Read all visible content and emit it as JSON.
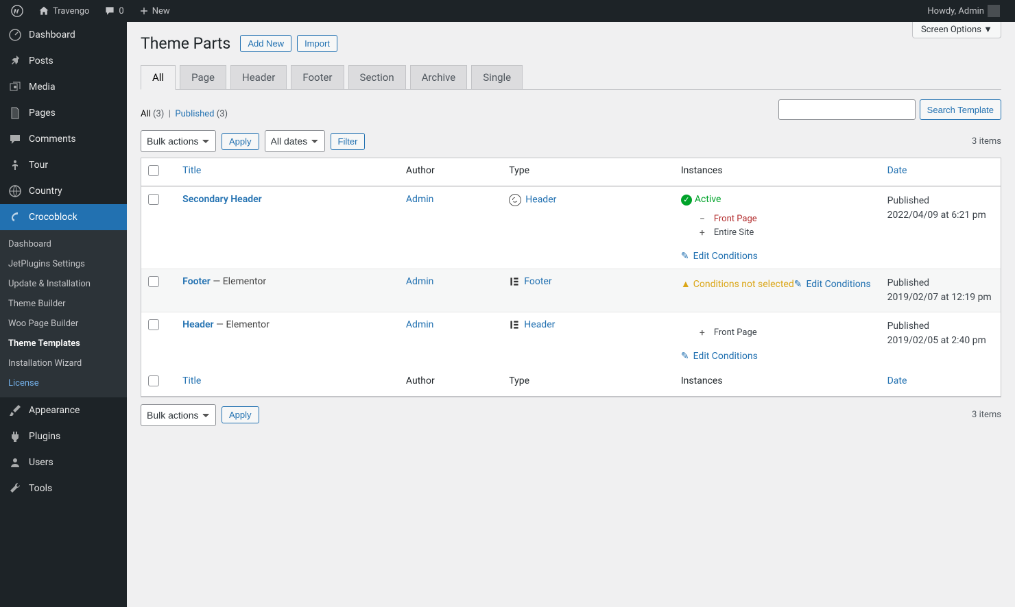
{
  "adminbar": {
    "site_name": "Travengo",
    "comments_count": "0",
    "new_label": "New",
    "howdy": "Howdy, Admin"
  },
  "sidebar": {
    "items": [
      {
        "label": "Dashboard",
        "icon": "dashboard"
      },
      {
        "label": "Posts",
        "icon": "pin"
      },
      {
        "label": "Media",
        "icon": "media"
      },
      {
        "label": "Pages",
        "icon": "page"
      },
      {
        "label": "Comments",
        "icon": "comment"
      },
      {
        "label": "Tour",
        "icon": "person"
      },
      {
        "label": "Country",
        "icon": "globe"
      },
      {
        "label": "Crocoblock",
        "icon": "croco"
      },
      {
        "label": "Appearance",
        "icon": "brush"
      },
      {
        "label": "Plugins",
        "icon": "plug"
      },
      {
        "label": "Users",
        "icon": "user"
      },
      {
        "label": "Tools",
        "icon": "wrench"
      }
    ],
    "submenu": [
      "Dashboard",
      "JetPlugins Settings",
      "Update & Installation",
      "Theme Builder",
      "Woo Page Builder",
      "Theme Templates",
      "Installation Wizard",
      "License"
    ]
  },
  "page": {
    "screen_options": "Screen Options",
    "title": "Theme Parts",
    "add_new": "Add New",
    "import": "Import",
    "tabs": [
      "All",
      "Page",
      "Header",
      "Footer",
      "Section",
      "Archive",
      "Single"
    ],
    "subsubsub_all": "All",
    "subsubsub_all_count": "(3)",
    "subsubsub_pub": "Published",
    "subsubsub_pub_count": "(3)",
    "bulk_actions": "Bulk actions",
    "apply": "Apply",
    "all_dates": "All dates",
    "filter": "Filter",
    "search_btn": "Search Template",
    "items_count": "3 items",
    "columns": {
      "title": "Title",
      "author": "Author",
      "type": "Type",
      "instances": "Instances",
      "date": "Date"
    },
    "edit_conditions": "Edit Conditions"
  },
  "rows": [
    {
      "title": "Secondary Header",
      "suffix": "",
      "author": "Admin",
      "type_icon": "gutenberg",
      "type": "Header",
      "status_kind": "active",
      "status_text": "Active",
      "conditions": [
        {
          "op": "exclude",
          "label": "Front Page"
        },
        {
          "op": "include",
          "label": "Entire Site"
        }
      ],
      "date_label": "Published",
      "date": "2022/04/09 at 6:21 pm"
    },
    {
      "title": "Footer",
      "suffix": " — Elementor",
      "author": "Admin",
      "type_icon": "elementor",
      "type": "Footer",
      "status_kind": "warn",
      "status_text": "Conditions not selected",
      "conditions": [],
      "date_label": "Published",
      "date": "2019/02/07 at 12:19 pm"
    },
    {
      "title": "Header",
      "suffix": " — Elementor",
      "author": "Admin",
      "type_icon": "elementor",
      "type": "Header",
      "status_kind": "none",
      "status_text": "",
      "conditions": [
        {
          "op": "include",
          "label": "Front Page"
        }
      ],
      "date_label": "Published",
      "date": "2019/02/05 at 2:40 pm"
    }
  ]
}
